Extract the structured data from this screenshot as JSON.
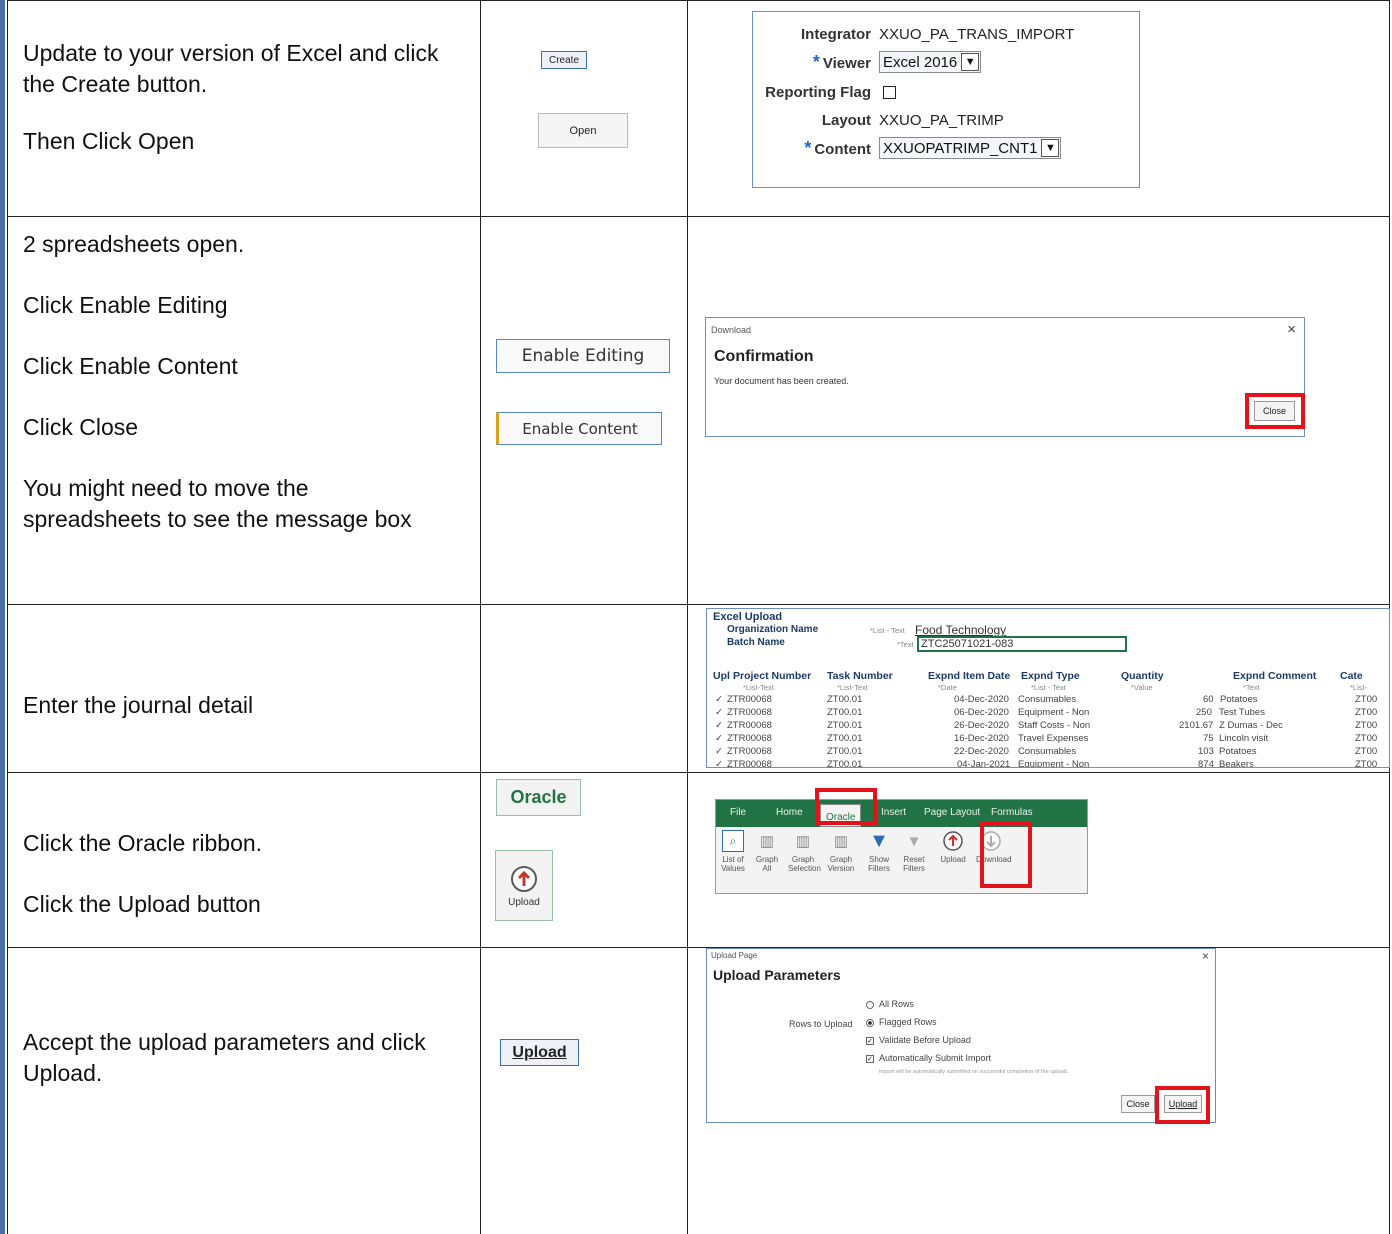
{
  "rows": [
    {
      "instructions": [
        "Update to your version of Excel and click the Create button.",
        "Then Click Open"
      ],
      "buttons": {
        "create": "Create",
        "open": "Open"
      },
      "params": {
        "integrator_label": "Integrator",
        "integrator_value": "XXUO_PA_TRANS_IMPORT",
        "viewer_label": "Viewer",
        "viewer_value": "Excel 2016",
        "reporting_flag_label": "Reporting Flag",
        "layout_label": "Layout",
        "layout_value": "XXUO_PA_TRIMP",
        "content_label": "Content",
        "content_value": "XXUOPATRIMP_CNT1",
        "required_mark": "*"
      }
    },
    {
      "instructions": [
        "2 spreadsheets open.",
        "Click Enable Editing",
        "Click Enable Content",
        "Click Close",
        "You might need to move the spreadsheets to see the message box"
      ],
      "buttons": {
        "enable_editing": "Enable Editing",
        "enable_content": "Enable Content"
      },
      "dialog": {
        "title": "Download",
        "close_x": "×",
        "heading": "Confirmation",
        "message": "Your document has been created.",
        "close_button": "Close"
      }
    },
    {
      "instructions": [
        "Enter the journal detail"
      ],
      "excel": {
        "title": "Excel Upload",
        "org_label": "Organization Name",
        "org_hint": "*List - Text",
        "org_value": "Food Technology",
        "batch_label": "Batch Name",
        "batch_hint": "*Text",
        "batch_value": "ZTC25071021-083",
        "headers": [
          "Upl",
          "Project Number",
          "Task Number",
          "Expnd Item Date",
          "Expnd Type",
          "Quantity",
          "Expnd Comment",
          "Cate"
        ],
        "subheaders": [
          "",
          "*List-Text",
          "*List-Text",
          "*Date",
          "*List - Text",
          "*Value",
          "*Text",
          "*List-"
        ],
        "data": [
          [
            "✓",
            "ZTR00068",
            "ZT00.01",
            "04-Dec-2020",
            "Consumables",
            "60",
            "Potatoes",
            "ZT00"
          ],
          [
            "✓",
            "ZTR00068",
            "ZT00.01",
            "06-Dec-2020",
            "Equipment - Non",
            "250",
            "Test Tubes",
            "ZT00"
          ],
          [
            "✓",
            "ZTR00068",
            "ZT00.01",
            "26-Dec-2020",
            "Staff Costs - Non",
            "2101.67",
            "Z Dumas - Dec",
            "ZT00"
          ],
          [
            "✓",
            "ZTR00068",
            "ZT00.01",
            "16-Dec-2020",
            "Travel Expenses",
            "75",
            "Lincoln visit",
            "ZT00"
          ],
          [
            "✓",
            "ZTR00068",
            "ZT00.01",
            "22-Dec-2020",
            "Consumables",
            "103",
            "Potatoes",
            "ZT00"
          ],
          [
            "✓",
            "ZTR00068",
            "ZT00.01",
            "04-Jan-2021",
            "Equipment - Non",
            "874",
            "Beakers",
            "ZT00"
          ]
        ]
      }
    },
    {
      "instructions": [
        "Click the Oracle ribbon.",
        "Click the Upload button"
      ],
      "buttons": {
        "oracle_tab": "Oracle",
        "upload": "Upload"
      },
      "ribbon": {
        "tabs": [
          "File",
          "Home",
          "Oracle",
          "Insert",
          "Page Layout",
          "Formulas"
        ],
        "items": [
          {
            "label": "List of Values",
            "icon": "list-of-values-icon"
          },
          {
            "label": "Graph All",
            "icon": "graph-icon"
          },
          {
            "label": "Graph Selection",
            "icon": "graph-selection-icon"
          },
          {
            "label": "Graph Version",
            "icon": "graph-version-icon"
          },
          {
            "label": "Show Filters",
            "icon": "filter-icon"
          },
          {
            "label": "Reset Filters",
            "icon": "reset-filter-icon"
          },
          {
            "label": "Upload",
            "icon": "upload-icon"
          },
          {
            "label": "Download",
            "icon": "download-icon"
          }
        ]
      }
    },
    {
      "instructions": [
        "Accept the upload parameters and click Upload."
      ],
      "buttons": {
        "upload": "Upload"
      },
      "upload_page": {
        "title": "Upload Page",
        "close_x": "×",
        "heading": "Upload Parameters",
        "rows_label": "Rows to Upload",
        "opt_all": "All Rows",
        "opt_flagged": "Flagged Rows",
        "validate": "Validate Before Upload",
        "auto_submit": "Automatically Submit Import",
        "note": "Import will be automatically submitted on successful completion of the upload.",
        "close_button": "Close",
        "upload_button": "Upload"
      }
    }
  ],
  "colors": {
    "highlight": "#e3121b",
    "frame": "#6d8fbf",
    "excel_green": "#217346",
    "required": "#2166c9"
  }
}
